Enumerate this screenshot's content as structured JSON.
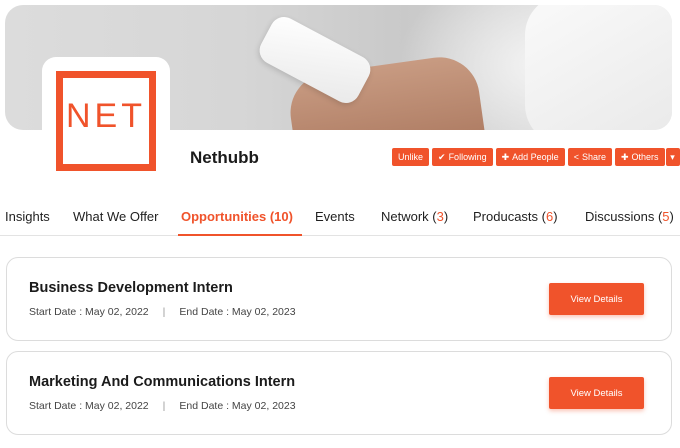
{
  "company": {
    "name": "Nethubb",
    "logo_text": "NET"
  },
  "actions": {
    "unlike": "Unlike",
    "following": "Following",
    "add_people": "Add People",
    "share": "Share",
    "others": "Others"
  },
  "tabs": [
    {
      "label": "Insights",
      "count": ""
    },
    {
      "label": "What We Offer",
      "count": ""
    },
    {
      "label": "Opportunities (10)",
      "count": ""
    },
    {
      "label": "Events",
      "count": ""
    },
    {
      "label": "Network (",
      "count": "3",
      "close": ")"
    },
    {
      "label": "Producasts (",
      "count": "6",
      "close": ")"
    },
    {
      "label": "Discussions (",
      "count": "5",
      "close": ")"
    }
  ],
  "opportunities": [
    {
      "title": "Business Development Intern",
      "start": "Start Date : May 02, 2022",
      "separator": "|",
      "end": "End Date : May 02, 2023",
      "button": "View Details"
    },
    {
      "title": "Marketing And Communications Intern",
      "start": "Start Date : May 02, 2022",
      "separator": "|",
      "end": "End Date : May 02, 2023",
      "button": "View Details"
    }
  ],
  "colors": {
    "accent": "#f0532b"
  },
  "icons": {
    "following": "check-icon",
    "add_people": "plus-icon",
    "share": "share-icon",
    "others": "plus-icon",
    "dropdown": "caret-down-icon"
  }
}
